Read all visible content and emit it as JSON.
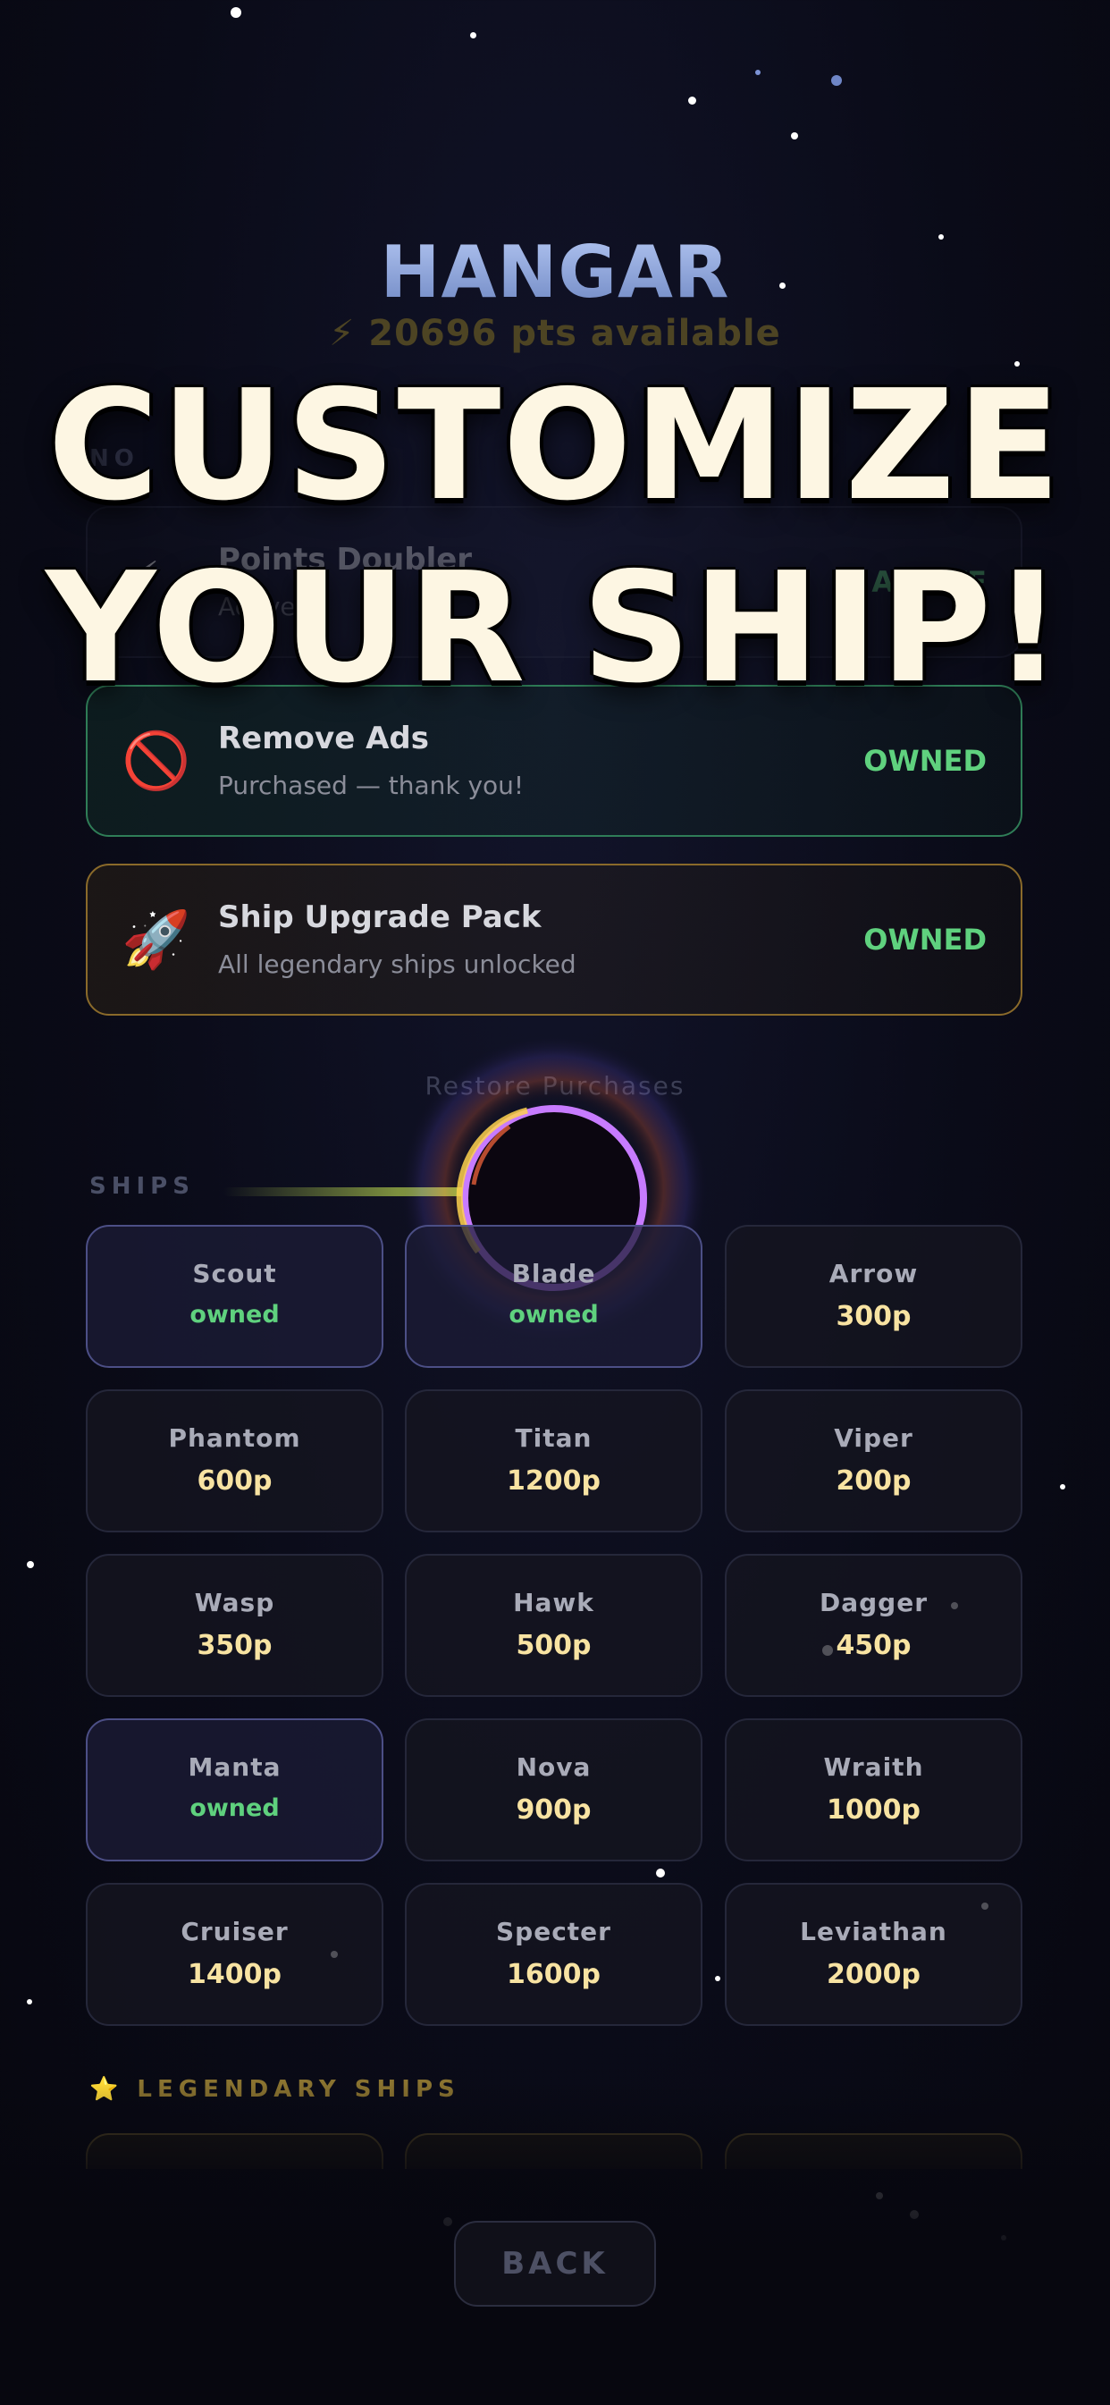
{
  "header": {
    "title": "HANGAR",
    "points": "⚡ 20696 pts available"
  },
  "overlay": {
    "line1": "CUSTOMIZE",
    "line2": "YOUR SHIP!"
  },
  "purchases": {
    "section_label": "NO",
    "items": [
      {
        "icon": "⚡",
        "title": "Points Doubler",
        "subtitle": "Active",
        "status": "ACTIVE"
      },
      {
        "icon": "🚫",
        "title": "Remove Ads",
        "subtitle": "Purchased — thank you!",
        "status": "OWNED"
      },
      {
        "icon": "🚀",
        "title": "Ship Upgrade Pack",
        "subtitle": "All legendary ships unlocked",
        "status": "OWNED"
      }
    ],
    "restore_label": "Restore Purchases"
  },
  "ships": {
    "section_label": "SHIPS",
    "owned_label": "owned",
    "items": [
      {
        "name": "Scout",
        "price": "",
        "owned": true
      },
      {
        "name": "Blade",
        "price": "",
        "owned": true
      },
      {
        "name": "Arrow",
        "price": "300p",
        "owned": false
      },
      {
        "name": "Phantom",
        "price": "600p",
        "owned": false
      },
      {
        "name": "Titan",
        "price": "1200p",
        "owned": false
      },
      {
        "name": "Viper",
        "price": "200p",
        "owned": false
      },
      {
        "name": "Wasp",
        "price": "350p",
        "owned": false
      },
      {
        "name": "Hawk",
        "price": "500p",
        "owned": false
      },
      {
        "name": "Dagger",
        "price": "450p",
        "owned": false
      },
      {
        "name": "Manta",
        "price": "",
        "owned": true
      },
      {
        "name": "Nova",
        "price": "900p",
        "owned": false
      },
      {
        "name": "Wraith",
        "price": "1000p",
        "owned": false
      },
      {
        "name": "Cruiser",
        "price": "1400p",
        "owned": false
      },
      {
        "name": "Specter",
        "price": "1600p",
        "owned": false
      },
      {
        "name": "Leviathan",
        "price": "2000p",
        "owned": false
      }
    ]
  },
  "legendary": {
    "section_label": "⭐ LEGENDARY SHIPS"
  },
  "footer": {
    "back_label": "BACK"
  },
  "colors": {
    "owned_green": "#5fd17e",
    "price_gold": "#f8e3a2",
    "title_blue": "#8ea6dd"
  }
}
